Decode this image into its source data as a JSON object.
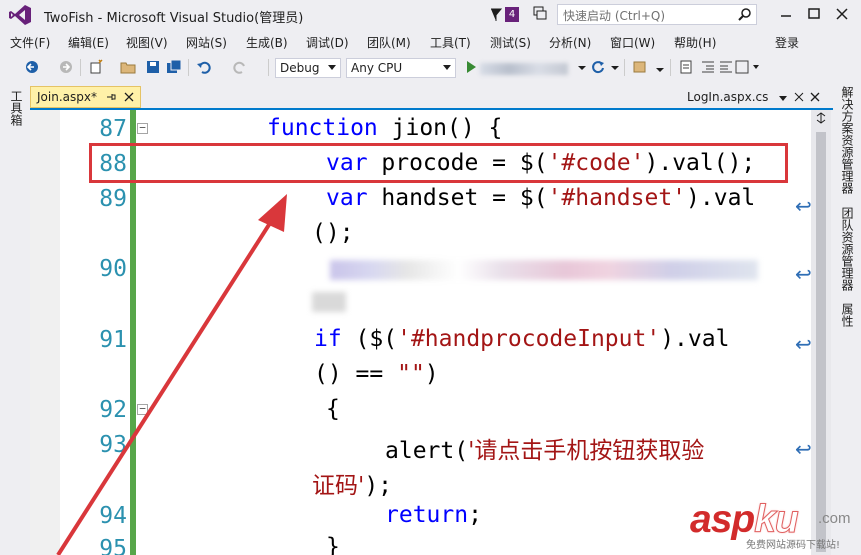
{
  "window": {
    "title": "TwoFish - Microsoft Visual Studio(管理员)",
    "notification_count": "4",
    "quick_launch_placeholder": "快速启动 (Ctrl+Q)",
    "sign_in": "登录"
  },
  "menu": [
    "文件(F)",
    "编辑(E)",
    "视图(V)",
    "网站(S)",
    "生成(B)",
    "调试(D)",
    "团队(M)",
    "工具(T)",
    "测试(S)",
    "分析(N)",
    "窗口(W)",
    "帮助(H)"
  ],
  "toolbar": {
    "configuration": "Debug",
    "platform": "Any CPU"
  },
  "left_strip": {
    "toolbox": "工具箱"
  },
  "right_strip": {
    "solution_explorer": "解决方案资源管理器",
    "team_explorer": "团队资源管理器",
    "properties": "属性"
  },
  "tabs": {
    "active": "Join.aspx*",
    "right": "LogIn.aspx.cs"
  },
  "editor": {
    "line_numbers": [
      "87",
      "88",
      "89",
      "90",
      "91",
      "92",
      "93",
      "94",
      "95"
    ],
    "code": {
      "l87_kw": "function",
      "l87_rest": " jion() {",
      "l88_kw": "var",
      "l88_a": " procode = $(",
      "l88_str": "'#code'",
      "l88_b": ").val();",
      "l89_kw": "var",
      "l89_a": " handset = $(",
      "l89_str": "'#handset'",
      "l89_b": ").val",
      "l89_cont": "();",
      "l91_kw": "if",
      "l91_a": " ($(",
      "l91_str": "'#handprocodeInput'",
      "l91_b": ").val",
      "l91_cont_a": "() == ",
      "l91_cont_str": "\"\"",
      "l91_cont_b": ")",
      "l92": "{",
      "l93_a": "alert(",
      "l93_str": "'请点击手机按钮获取验",
      "l93_cont_str": "证码'",
      "l93_cont_b": ");",
      "l94_kw": "return",
      "l94_b": ";",
      "l95": "}"
    }
  },
  "watermark": {
    "brand_a": "asp",
    "brand_b": "ku",
    "tld": ".com",
    "tagline": "免费网站源码下载站!"
  },
  "colors": {
    "keyword": "#0000ff",
    "string": "#a31515",
    "line_number": "#2b91af",
    "annotation": "#d9373b",
    "accent": "#007acc"
  }
}
